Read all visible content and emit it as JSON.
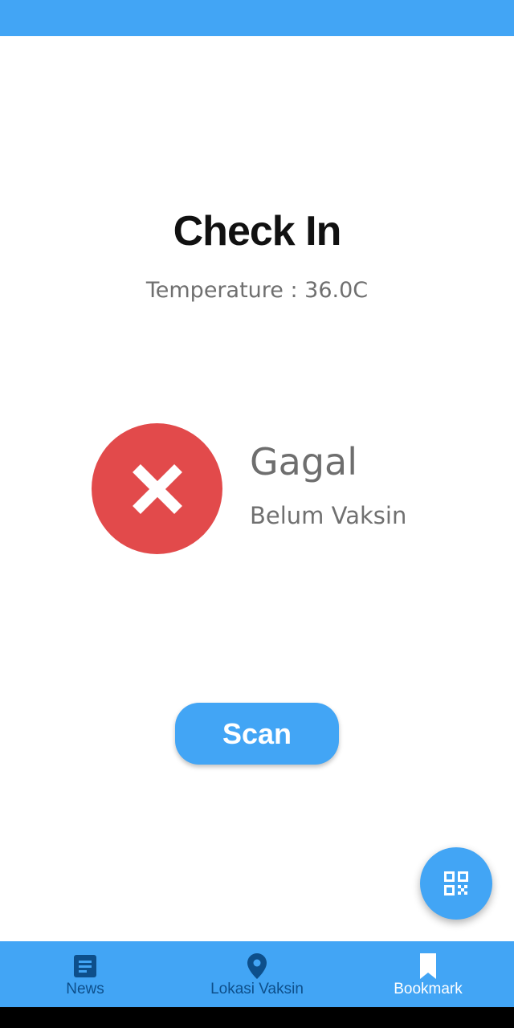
{
  "header": {
    "title": "Check In",
    "temperature": "Temperature : 36.0C"
  },
  "status": {
    "icon": "close-icon",
    "title": "Gagal",
    "subtitle": "Belum Vaksin",
    "color": "#e24a4b"
  },
  "actions": {
    "scan_label": "Scan",
    "fab_icon": "qr-code-icon"
  },
  "bottom_nav": {
    "items": [
      {
        "label": "News",
        "icon": "news-icon",
        "active": false
      },
      {
        "label": "Lokasi Vaksin",
        "icon": "location-pin-icon",
        "active": false
      },
      {
        "label": "Bookmark",
        "icon": "bookmark-icon",
        "active": true
      }
    ],
    "active_color": "#ffffff",
    "inactive_color": "#0d4f8b"
  },
  "colors": {
    "primary": "#42a5f5",
    "error": "#e24a4b"
  }
}
